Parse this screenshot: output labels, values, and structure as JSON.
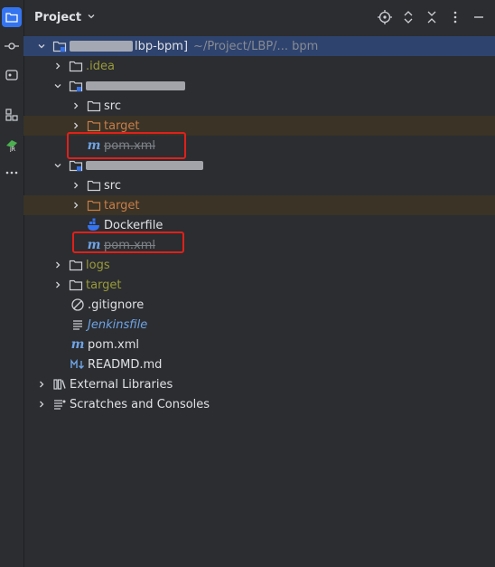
{
  "header": {
    "title": "Project"
  },
  "tree": {
    "root": {
      "label_blur": "lbp-bpm]",
      "path": "~/Project/LBP/... bpm"
    },
    "idea": ".idea",
    "module1": {
      "label_blur": ""
    },
    "m1_src": "src",
    "m1_target": "target",
    "m1_pom": "pom.xml",
    "module2": {
      "label_blur": ""
    },
    "m2_src": "src",
    "m2_target": "target",
    "m2_dockerfile": "Dockerfile",
    "m2_pom": "pom.xml",
    "logs": "logs",
    "target": "target",
    "gitignore": ".gitignore",
    "jenkinsfile": "Jenkinsfile",
    "pom": "pom.xml",
    "readme": "READMD.md",
    "external": "External Libraries",
    "scratches": "Scratches and Consoles"
  },
  "colors": {
    "accent": "#3574f0",
    "selection": "#2e436e",
    "excluded": "#3a3326",
    "highlight": "#e0201b"
  }
}
